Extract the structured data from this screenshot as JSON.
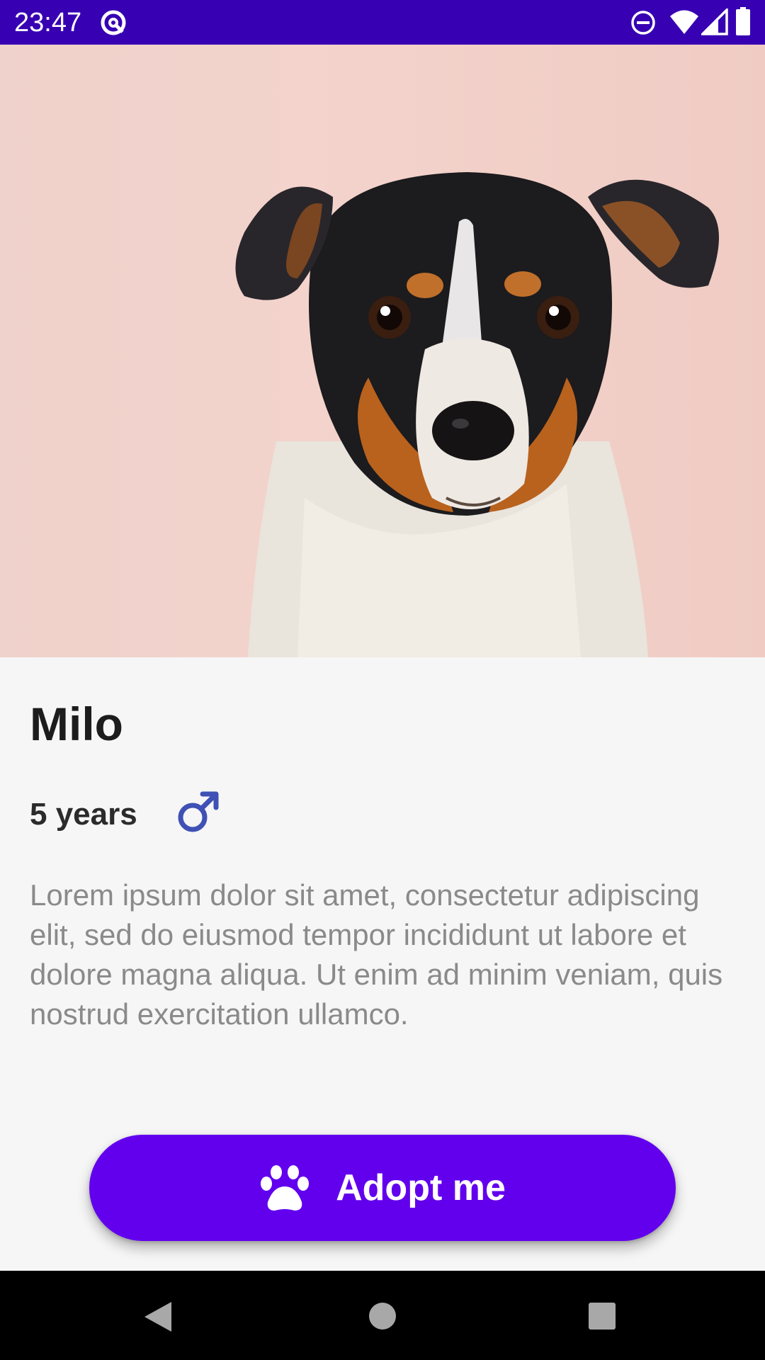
{
  "status_bar": {
    "time": "23:47",
    "icons": [
      "app-notification-icon",
      "do-not-disturb-icon",
      "wifi-icon",
      "cell-signal-icon",
      "battery-icon"
    ],
    "background": "#3700b3"
  },
  "hero": {
    "subject": "dog-photo"
  },
  "pet": {
    "name": "Milo",
    "age": "5 years",
    "gender_icon": "male-icon",
    "description": "Lorem ipsum dolor sit amet, consectetur adipiscing elit, sed do eiusmod tempor incididunt ut labore et dolore magna aliqua. Ut enim ad minim veniam, quis nostrud exercitation ullamco."
  },
  "adopt_button": {
    "label": "Adopt me",
    "icon": "paw-icon",
    "color": "#6200ee"
  },
  "nav_bar": {
    "buttons": [
      "back-icon",
      "home-icon",
      "recents-icon"
    ]
  },
  "colors": {
    "accent": "#6200ee",
    "status_bar": "#3700b3",
    "gender_icon": "#3f51b5",
    "background": "#f6f6f6"
  }
}
